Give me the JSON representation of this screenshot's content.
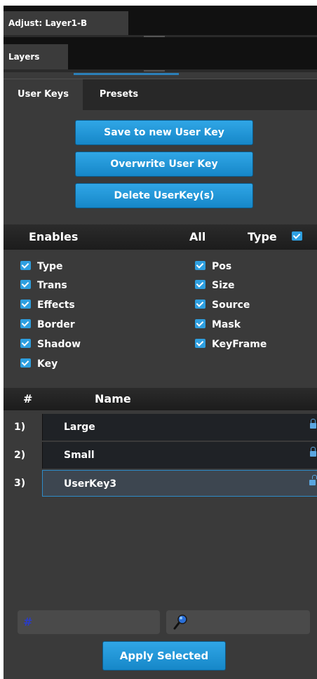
{
  "window": {
    "tab_label": "Adjust: Layer1-B"
  },
  "layers": {
    "tab_label": "Layers"
  },
  "tabs": [
    {
      "label": "User Keys",
      "active": true
    },
    {
      "label": "Presets",
      "active": false
    }
  ],
  "actions": {
    "save_label": "Save to new User Key",
    "overwrite_label": "Overwrite User Key",
    "delete_label": "Delete UserKey(s)"
  },
  "enables": {
    "header": "Enables",
    "all_label": "All",
    "type_label": "Type",
    "type_checked": true,
    "left": [
      {
        "label": "Type",
        "checked": true
      },
      {
        "label": "Trans",
        "checked": true
      },
      {
        "label": "Effects",
        "checked": true
      },
      {
        "label": "Border",
        "checked": true
      },
      {
        "label": "Shadow",
        "checked": true
      },
      {
        "label": "Key",
        "checked": true
      }
    ],
    "right": [
      {
        "label": "Pos",
        "checked": true
      },
      {
        "label": "Size",
        "checked": true
      },
      {
        "label": "Source",
        "checked": true
      },
      {
        "label": "Mask",
        "checked": true
      },
      {
        "label": "KeyFrame",
        "checked": true
      }
    ]
  },
  "list": {
    "col_num": "#",
    "col_name": "Name",
    "rows": [
      {
        "num": "1)",
        "name": "Large",
        "locked": true
      },
      {
        "num": "2)",
        "name": "Small",
        "locked": true
      },
      {
        "num": "3)",
        "name": "UserKey3",
        "locked": false,
        "selected": true
      }
    ]
  },
  "footer": {
    "number_glyph": "#",
    "search_icon": "magnifier-icon",
    "apply_label": "Apply Selected"
  },
  "colors": {
    "accent": "#1f95d8",
    "panel": "#3a3a3a"
  }
}
